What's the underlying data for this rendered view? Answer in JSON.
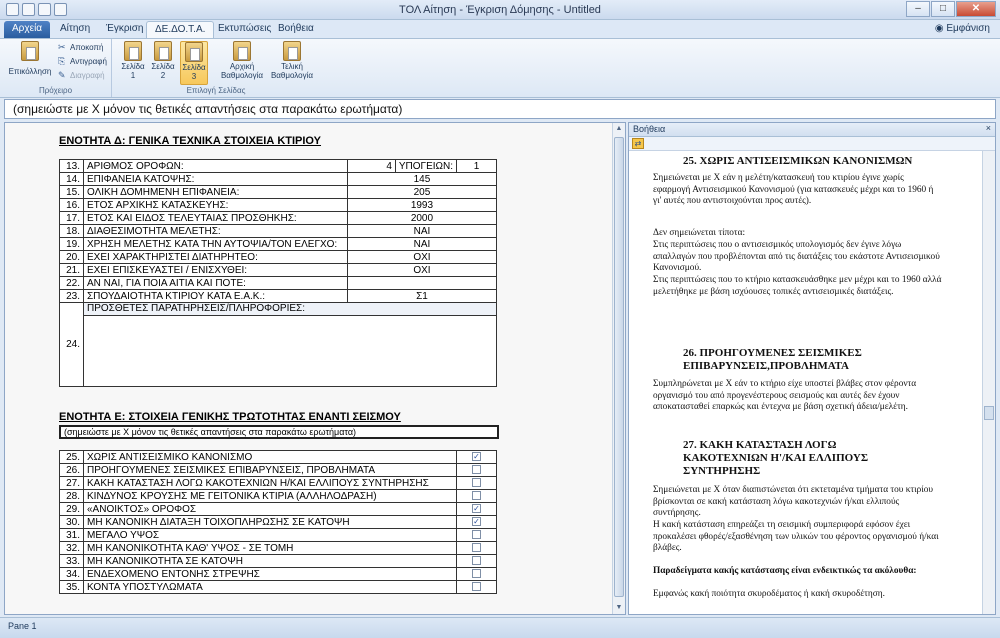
{
  "window": {
    "title": "ΤΟΛ Αίτηση - Έγκριση Δόμησης - Untitled",
    "buttons": [
      "–",
      "□",
      "✕"
    ]
  },
  "tabs": [
    "Αρχεία",
    "Αίτηση",
    "Έγκριση",
    "ΔΕ.ΔΟ.Τ.Α.",
    "Εκτυπώσεις",
    "Βοήθεια"
  ],
  "tab_right": "Εμφάνιση",
  "ribbon": {
    "paste": "Επικόλληση",
    "cut": "Αποκοπή",
    "copy": "Αντιγραφή",
    "delete": "Διαγραφή",
    "clipboard_group": "Πρόχειρο",
    "page1": [
      "Σελίδα",
      "1"
    ],
    "page2": [
      "Σελίδα",
      "2"
    ],
    "page3": [
      "Σελίδα",
      "3"
    ],
    "initial": [
      "Αρχική",
      "Βαθμολογία"
    ],
    "final": [
      "Τελική",
      "Βαθμολογία"
    ],
    "page_group": "Επιλογή Σελίδας"
  },
  "note_bar": "(σημειώστε με Χ μόνον τις θετικές απαντήσεις στα παρακάτω ερωτήματα)",
  "section_d": {
    "title": "ΕΝΟΤΗΤΑ Δ: ΓΕΝΙΚΑ ΤΕΧΝΙΚΑ ΣΤΟΙΧΕΙΑ ΚΤΙΡΙΟΥ",
    "row13": {
      "num": "13.",
      "label": "ΑΡΙΘΜΟΣ ΟΡΟΦΩΝ:",
      "val": "4",
      "sub_label": "ΥΠΟΓΕΙΩΝ:",
      "sub_val": "1"
    },
    "rows": [
      {
        "num": "14.",
        "label": "ΕΠΙΦΑΝΕΙΑ ΚΑΤΟΨΗΣ:",
        "val": "145"
      },
      {
        "num": "15.",
        "label": "ΟΛΙΚΗ ΔΟΜΗΜΕΝΗ ΕΠΙΦΑΝΕΙΑ:",
        "val": "205"
      },
      {
        "num": "16.",
        "label": "ΕΤΟΣ ΑΡΧΙΚΗΣ ΚΑΤΑΣΚΕΥΗΣ:",
        "val": "1993"
      },
      {
        "num": "17.",
        "label": "ΕΤΟΣ ΚΑΙ ΕΙΔΟΣ ΤΕΛΕΥΤΑΙΑΣ ΠΡΟΣΘΗΚΗΣ:",
        "val": "2000"
      },
      {
        "num": "18.",
        "label": "ΔΙΑΘΕΣΙΜΟΤΗΤΑ ΜΕΛΕΤΗΣ:",
        "val": "ΝΑΙ"
      },
      {
        "num": "19.",
        "label": "ΧΡΗΣΗ ΜΕΛΕΤΗΣ ΚΑΤΑ ΤΗΝ ΑΥΤΟΨΙΑ/ΤΟΝ ΕΛΕΓΧΟ:",
        "val": "ΝΑΙ"
      },
      {
        "num": "20.",
        "label": "ΕΧΕΙ ΧΑΡΑΚΤΗΡΙΣΤΕΙ ΔΙΑΤΗΡΗΤΕΟ:",
        "val": "ΟΧΙ"
      },
      {
        "num": "21.",
        "label": "ΕΧΕΙ ΕΠΙΣΚΕΥΑΣΤΕΙ / ΕΝΙΣΧΥΘΕΙ:",
        "val": "ΟΧΙ"
      },
      {
        "num": "22.",
        "label": "ΑΝ ΝΑΙ, ΓΙΑ ΠΟΙΑ ΑΙΤΙΑ ΚΑΙ ΠΟΤΕ:",
        "val": ""
      },
      {
        "num": "23.",
        "label": "ΣΠΟΥΔΑΙΟΤΗΤΑ ΚΤΙΡΙΟΥ ΚΑΤΑ Ε.Α.Κ.:",
        "val": "Σ1"
      }
    ],
    "row24": {
      "num": "24.",
      "label": "ΠΡΟΣΘΕΤΕΣ ΠΑΡΑΤΗΡΗΣΕΙΣ/ΠΛΗΡΟΦΟΡΙΕΣ:",
      "value": ""
    }
  },
  "section_e": {
    "title": "ΕΝΟΤΗΤΑ Ε: ΣΤΟΙΧΕΙΑ ΓΕΝΙΚΗΣ ΤΡΩΤΟΤΗΤΑΣ ΕΝΑΝΤΙ ΣΕΙΣΜΟΥ",
    "note": "(σημειώστε με Χ μόνον τις θετικές απαντήσεις στα παρακάτω ερωτήματα)",
    "rows": [
      {
        "num": "25.",
        "label": "ΧΩΡΙΣ ΑΝΤΙΣΕΙΣΜΙΚΟ ΚΑΝΟΝΙΣΜΟ",
        "checked": true
      },
      {
        "num": "26.",
        "label": "ΠΡΟΗΓΟΥΜΕΝΕΣ ΣΕΙΣΜΙΚΕΣ ΕΠΙΒΑΡΥΝΣΕΙΣ, ΠΡΟΒΛΗΜΑΤΑ",
        "checked": false
      },
      {
        "num": "27.",
        "label": "ΚΑΚΗ ΚΑΤΑΣΤΑΣΗ ΛΟΓΩ ΚΑΚΟΤΕΧΝΙΩΝ Η/ΚΑΙ ΕΛΛΙΠΟΥΣ ΣΥΝΤΗΡΗΣΗΣ",
        "checked": false
      },
      {
        "num": "28.",
        "label": "ΚΙΝΔΥΝΟΣ ΚΡΟΥΣΗΣ ΜΕ ΓΕΙΤΟΝΙΚΑ ΚΤΙΡΙΑ (ΑΛΛΗΛΟΔΡΑΣΗ)",
        "checked": false
      },
      {
        "num": "29.",
        "label": "«ΑΝΟΙΚΤΟΣ» ΟΡΟΦΟΣ",
        "checked": true
      },
      {
        "num": "30.",
        "label": "ΜΗ ΚΑΝΟΝΙΚΗ ΔΙΑΤΑΞΗ ΤΟΙΧΟΠΛΗΡΩΣΗΣ ΣΕ ΚΑΤΟΨΗ",
        "checked": true
      },
      {
        "num": "31.",
        "label": "ΜΕΓΑΛΟ ΥΨΟΣ",
        "checked": false
      },
      {
        "num": "32.",
        "label": "ΜΗ ΚΑΝΟΝΙΚΟΤΗΤΑ ΚΑΘ' ΥΨΟΣ - ΣΕ ΤΟΜΗ",
        "checked": false
      },
      {
        "num": "33.",
        "label": "ΜΗ ΚΑΝΟΝΙΚΟΤΗΤΑ ΣΕ ΚΑΤΟΨΗ",
        "checked": false
      },
      {
        "num": "34.",
        "label": "ΕΝΔΕΧΟΜΕΝΟ ΕΝΤΟΝΗΣ ΣΤΡΕΨΗΣ",
        "checked": false
      },
      {
        "num": "35.",
        "label": "ΚΟΝΤΑ ΥΠΟΣΤΥΛΩΜΑΤΑ",
        "checked": false
      }
    ]
  },
  "help": {
    "title": "Βοήθεια",
    "close": "×",
    "h25": "25. ΧΩΡΙΣ ΑΝΤΙΣΕΙΣΜΙΚΩΝ ΚΑΝΟΝΙΣΜΩΝ",
    "p25a": "Σημειώνεται με Χ εάν η μελέτη/κατασκευή του κτιρίου έγινε χωρίς εφαρμογή Αντισεισμικού Κανονισμού (για κατασκευές μέχρι και το 1960 ή γι' αυτές που αντιστοιχούνται προς αυτές).",
    "p25b": "Δεν σημειώνεται τίποτα:",
    "p25c": "Στις περιπτώσεις που ο αντισεισμικός υπολογισμός δεν έγινε λόγω απαλλαγών που προβλέπονται από τις διατάξεις του εκάστοτε Αντισεισμικού Κανονισμού.",
    "p25d": "Στις περιπτώσεις που το κτήριο κατασκευάσθηκε μεν μέχρι και το 1960 αλλά μελετήθηκε με βάση ισχύουσες τοπικές αντισεισμικές διατάξεις.",
    "h26": "26. ΠΡΟΗΓΟΥΜΕΝΕΣ ΣΕΙΣΜΙΚΕΣ ΕΠΙΒΑΡΥΝΣΕΙΣ,ΠΡΟΒΛΗΜΑΤΑ",
    "p26": "Συμπληρώνεται με Χ εάν το κτήριο είχε υποστεί βλάβες στον φέροντα οργανισμό του από προγενέστερους σεισμούς και αυτές δεν έχουν αποκατασταθεί επαρκώς και έντεχνα με βάση σχετική άδεια/μελέτη.",
    "h27": "27. ΚΑΚΗ ΚΑΤΑΣΤΑΣΗ ΛΟΓΩ ΚΑΚΟΤΕΧΝΙΩΝ Η'/ΚΑΙ ΕΛΛΙΠΟΥΣ ΣΥΝΤΗΡΗΣΗΣ",
    "p27a": "Σημειώνεται με Χ όταν διαπιστώνεται ότι εκτεταμένα τμήματα του κτιρίου βρίσκονται σε κακή κατάσταση λόγω κακοτεχνιών ή/και ελλιπούς συντήρησης.",
    "p27b": "Η κακή κατάσταση επηρεάζει τη σεισμική συμπεριφορά εφόσον έχει προκαλέσει φθορές/εξασθένηση των υλικών του φέροντος οργανισμού ή/και βλάβες.",
    "p27c": "Παραδείγματα κακής κατάστασης είναι ενδεικτικώς τα ακόλουθα:",
    "p27d": "Εμφανώς κακή ποιότητα σκυροδέματος ή κακή σκυροδέτηση."
  },
  "status": "Pane 1"
}
